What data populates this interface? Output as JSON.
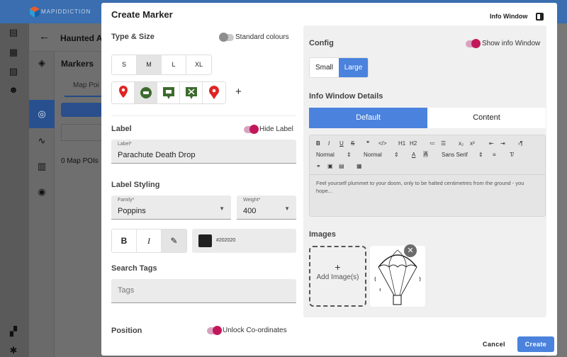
{
  "app": {
    "logo_text": "MAPIDDICTION",
    "panel_title": "Haunted Ar",
    "markers_title": "Markers",
    "tab_map_pois": "Map Poi",
    "poi_count": "0 Map POIs"
  },
  "modal": {
    "title": "Create Marker",
    "info_window_toggle": "Info Window",
    "type_size": {
      "title": "Type & Size",
      "standard_colours_label": "Standard colours",
      "standard_colours_on": false,
      "sizes": [
        "S",
        "M",
        "L",
        "XL"
      ],
      "selected_size": "M",
      "marker_types": [
        "red-pin-icon",
        "green-car-icon",
        "green-ticket-icon",
        "green-cutlery-icon",
        "red-pin-alt-icon"
      ],
      "add_label": "+"
    },
    "label": {
      "title": "Label",
      "hide_label": "Hide Label",
      "hide_label_on": true,
      "field_caption": "Label*",
      "field_value": "Parachute Death Drop"
    },
    "label_styling": {
      "title": "Label Styling",
      "family_caption": "Family*",
      "family_value": "Poppins",
      "weight_caption": "Weight*",
      "weight_value": "400",
      "style_buttons": [
        "B",
        "I",
        "✎"
      ],
      "color_value": "#202020"
    },
    "search_tags": {
      "title": "Search Tags",
      "placeholder": "Tags"
    },
    "position": {
      "title": "Position",
      "unlock_label": "Unlock Co-ordinates",
      "unlock_on": true
    },
    "config": {
      "title": "Config",
      "show_info_window": "Show info Window",
      "show_info_window_on": true,
      "sizes": [
        "Small",
        "Large"
      ],
      "selected_size": "Large",
      "details_title": "Info Window Details",
      "tabs": [
        "Default",
        "Content"
      ],
      "active_tab": "Default",
      "toolbar": {
        "row1": [
          "B",
          "I",
          "U",
          "S",
          "❞",
          "</>",
          "H1",
          "H2",
          "≔",
          "☰",
          "x₂",
          "x²",
          "⇤",
          "⇥",
          "›¶"
        ],
        "row2": [
          "Normal",
          "Normal",
          "A",
          "A",
          "Sans Serif",
          "≡",
          "T̸"
        ]
      },
      "description": "Feel yourself plummet to your doom, only to be halted centimetres from the ground - you hope...",
      "images_title": "Images",
      "add_image_label": "Add Image(s)",
      "add_image_plus": "+"
    },
    "footer": {
      "cancel": "Cancel",
      "create": "Create"
    }
  },
  "colors": {
    "accent": "#4a82dd",
    "toggle_on": "#c2185b",
    "marker_green": "#3d6a2e",
    "marker_red": "#e02424"
  }
}
